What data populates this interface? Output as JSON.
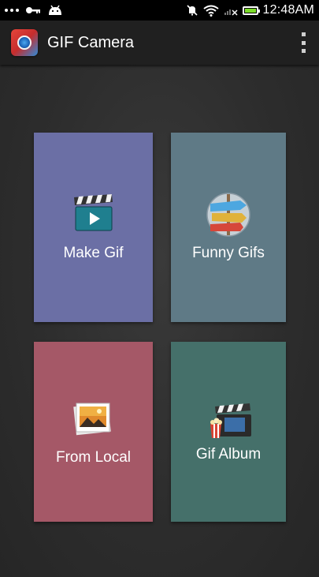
{
  "status_bar": {
    "time": "12:48AM",
    "icons": [
      "more-dots-icon",
      "key-icon",
      "android-icon",
      "mute-icon",
      "wifi-icon",
      "no-signal-icon",
      "battery-icon"
    ]
  },
  "action_bar": {
    "title": "GIF Camera",
    "app_icon": "gif-camera-app-icon",
    "overflow_icon": "overflow-menu-icon"
  },
  "tiles": [
    {
      "label": "Make Gif",
      "icon": "clapperboard-play-icon",
      "color": "#6b6fa5"
    },
    {
      "label": "Funny Gifs",
      "icon": "signpost-arrows-icon",
      "color": "#5f7a86"
    },
    {
      "label": "From Local",
      "icon": "photo-stack-icon",
      "color": "#a55867"
    },
    {
      "label": "Gif Album",
      "icon": "clapperboard-popcorn-icon",
      "color": "#45706a"
    }
  ]
}
